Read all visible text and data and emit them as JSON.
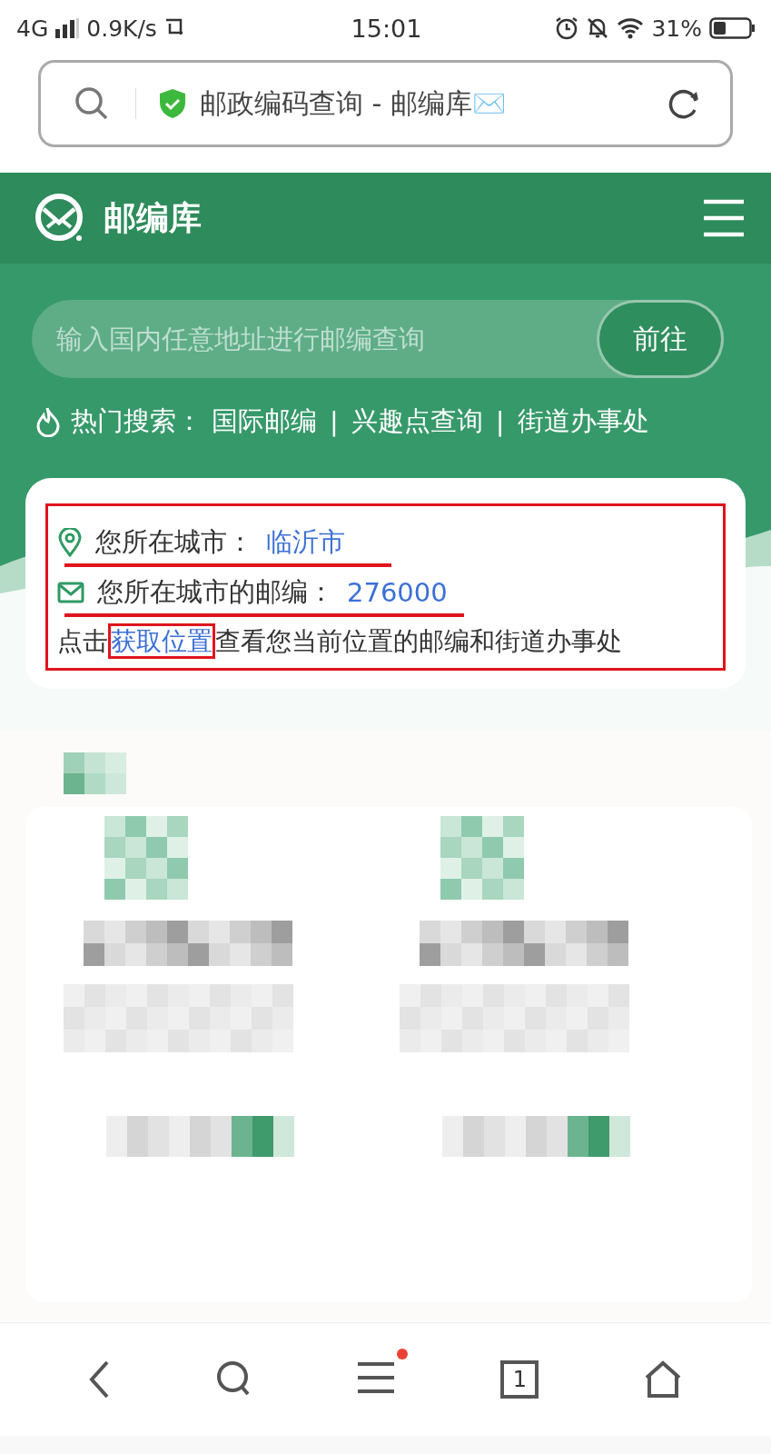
{
  "status_bar": {
    "network": "4G",
    "speed": "0.9K/s",
    "time": "15:01",
    "battery": "31%"
  },
  "address_bar": {
    "title": "邮政编码查询 - 邮编库✉️"
  },
  "header": {
    "brand": "邮编库"
  },
  "search": {
    "placeholder": "输入国内任意地址进行邮编查询",
    "button": "前往"
  },
  "hot_search": {
    "label": "热门搜索：",
    "links": [
      "国际邮编",
      "兴趣点查询",
      "街道办事处"
    ],
    "separators": [
      "|",
      "|"
    ]
  },
  "location_card": {
    "highlighted": true,
    "lines": [
      {
        "kind": "pin",
        "label": "您所在城市：",
        "value": "临沂市",
        "underlined": true
      },
      {
        "kind": "mail",
        "label": "您所在城市的邮编：",
        "value": "276000",
        "underlined": true
      }
    ],
    "hint": {
      "before": "点击",
      "link": "获取位置",
      "after": "查看您当前位置的邮编和街道办事处",
      "boxed": true
    }
  },
  "bottom_nav": {
    "tab_count": "1",
    "menu_badge": true
  }
}
